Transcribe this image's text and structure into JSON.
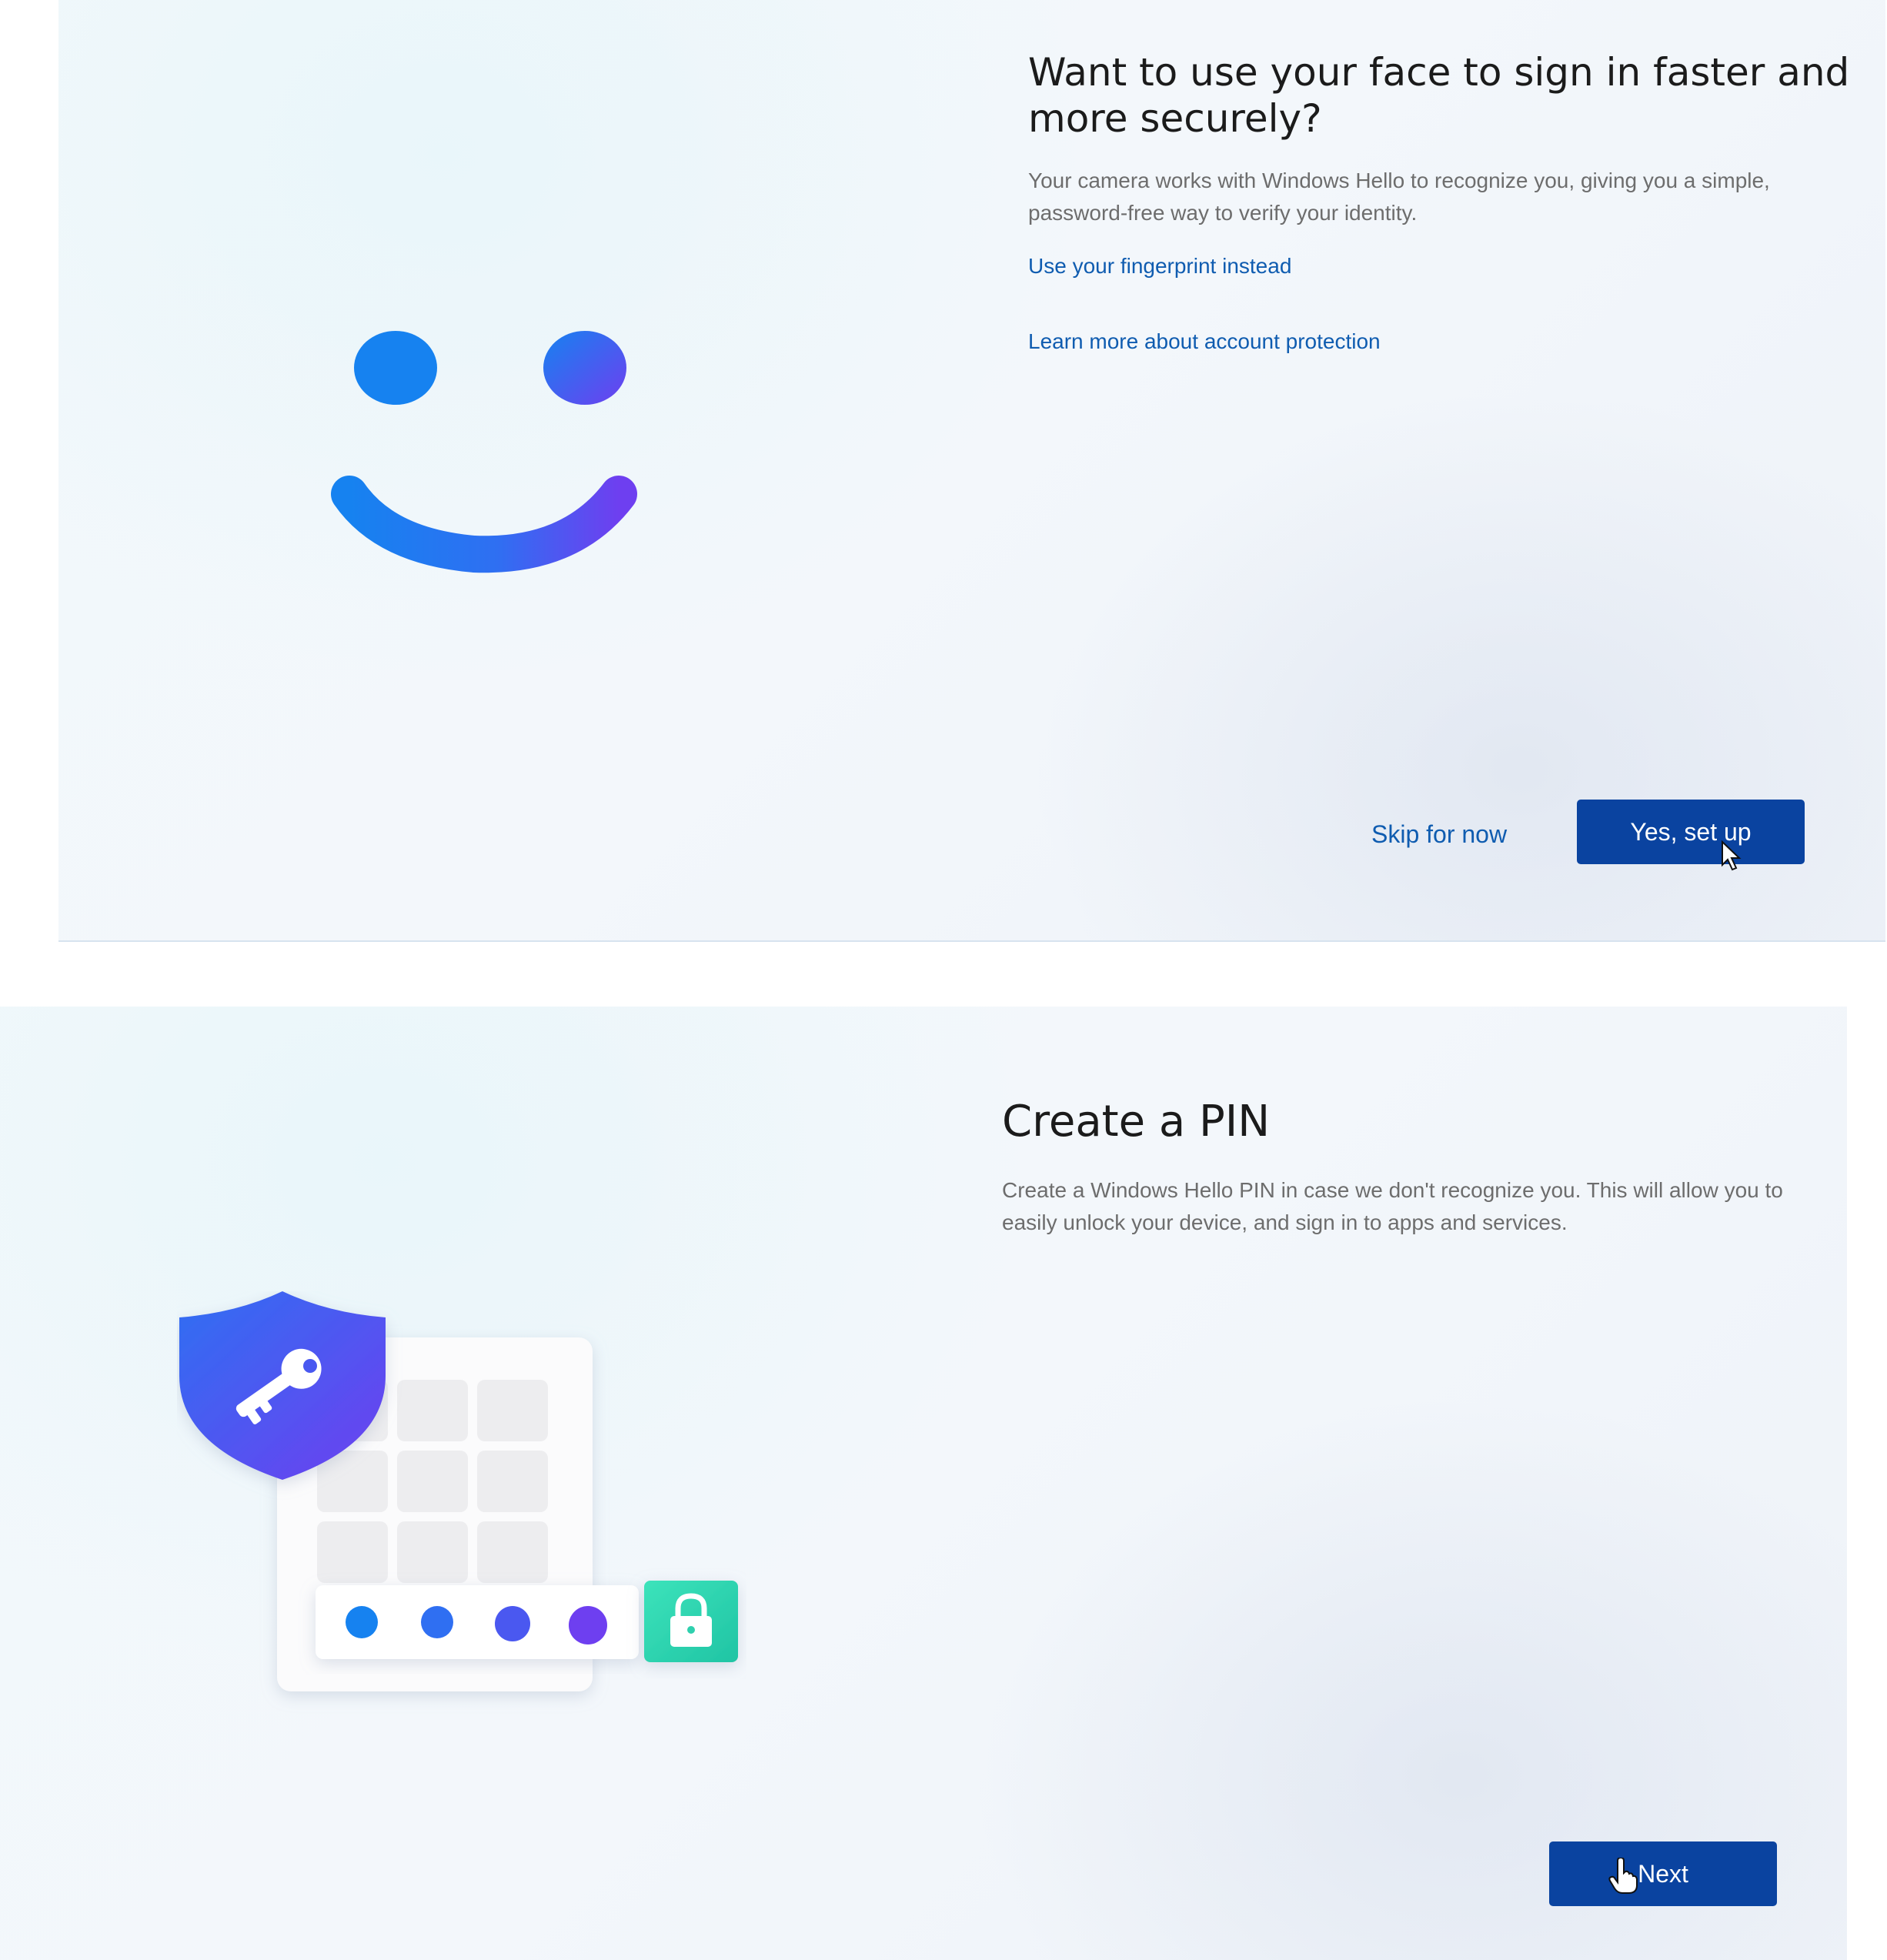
{
  "face_screen": {
    "heading": "Want to use your face to sign in faster and more securely?",
    "body": "Your camera works with Windows Hello to recognize you, giving you a simple, password-free way to verify your identity.",
    "link_fingerprint": "Use your fingerprint instead",
    "link_learn_more": "Learn more about account protection",
    "skip_label": "Skip for now",
    "primary_label": "Yes, set up",
    "illustration": "smiley-face-icon"
  },
  "pin_screen": {
    "heading": "Create a PIN",
    "body": "Create a Windows Hello PIN in case we don't recognize you. This will allow you to easily unlock your device, and sign in to apps and services.",
    "primary_label": "Next",
    "illustration": "pin-keypad-shield-icon"
  },
  "colors": {
    "accent": "#0a43a0",
    "link": "#0f5cb0",
    "face_gradient_start": "#1682f0",
    "face_gradient_end": "#6e3ff0",
    "lock_teal": "#2fd8b0"
  }
}
